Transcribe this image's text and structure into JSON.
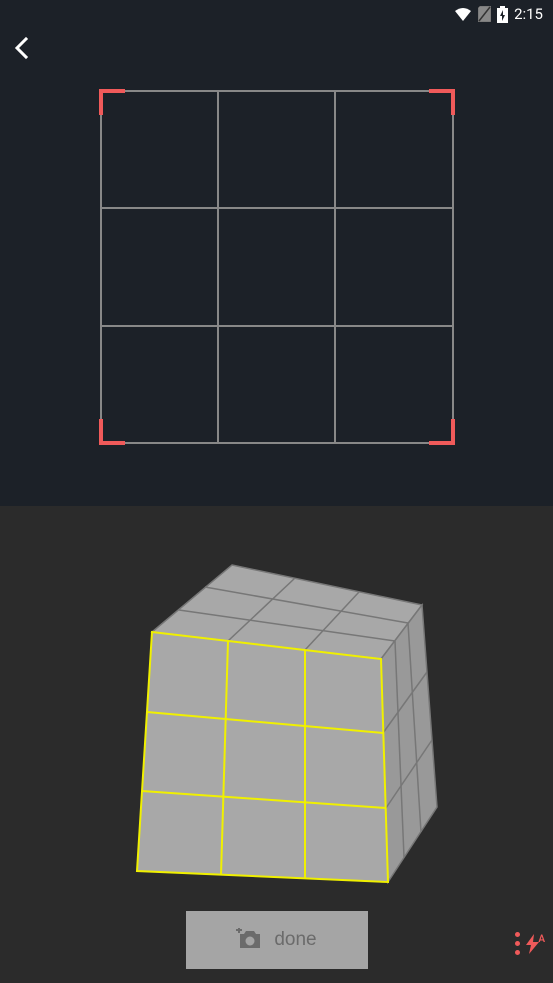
{
  "status_bar": {
    "time": "2:15"
  },
  "capture": {
    "grid_size": 3,
    "corner_color": "#f05a5a"
  },
  "cube": {
    "highlight_face": "front",
    "highlight_color": "#f0f000"
  },
  "actions": {
    "done_label": "done"
  },
  "flash_mode": "A"
}
